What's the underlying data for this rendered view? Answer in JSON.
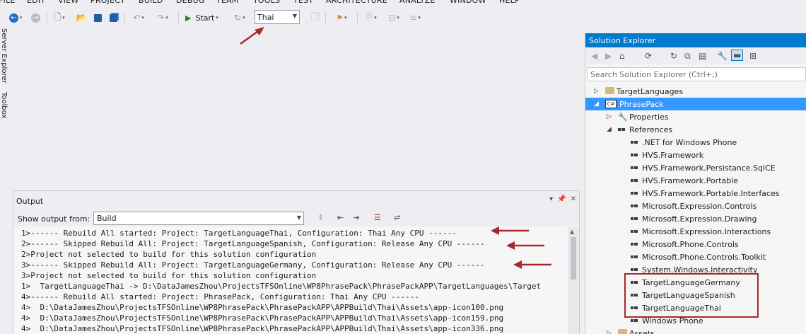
{
  "menu": [
    "FILE",
    "EDIT",
    "VIEW",
    "PROJECT",
    "BUILD",
    "DEBUG",
    "TEAM",
    "TOOLS",
    "TEST",
    "ARCHITECTURE",
    "ANALYZE",
    "WINDOW",
    "HELP"
  ],
  "toolbar": {
    "start_label": "Start",
    "configuration": "Thai"
  },
  "left_tabs": [
    "Server Explorer",
    "Toolbox"
  ],
  "output": {
    "title": "Output",
    "show_from_label": "Show output from:",
    "source": "Build",
    "lines": [
      "1>------ Rebuild All started: Project: TargetLanguageThai, Configuration: Thai Any CPU ------",
      "2>------ Skipped Rebuild All: Project: TargetLanguageSpanish, Configuration: Release Any CPU ------",
      "2>Project not selected to build for this solution configuration",
      "3>------ Skipped Rebuild All: Project: TargetLanguageGermany, Configuration: Release Any CPU ------",
      "3>Project not selected to build for this solution configuration",
      "1>  TargetLanguageThai -> D:\\DataJamesZhou\\ProjectsTFSOnline\\WP8PhrasePack\\PhrasePackAPP\\TargetLanguages\\Target",
      "4>------ Rebuild All started: Project: PhrasePack, Configuration: Thai Any CPU ------",
      "4>  D:\\DataJamesZhou\\ProjectsTFSOnline\\WP8PhrasePack\\PhrasePackAPP\\APPBuild\\Thai\\Assets\\app-icon100.png",
      "4>  D:\\DataJamesZhou\\ProjectsTFSOnline\\WP8PhrasePack\\PhrasePackAPP\\APPBuild\\Thai\\Assets\\app-icon159.png",
      "4>  D:\\DataJamesZhou\\ProjectsTFSOnline\\WP8PhrasePack\\PhrasePackAPP\\APPBuild\\Thai\\Assets\\app-icon336.png"
    ]
  },
  "solution_explorer": {
    "title": "Solution Explorer",
    "search_placeholder": "Search Solution Explorer (Ctrl+;)",
    "tree": [
      {
        "label": "TargetLanguages",
        "icon": "folder-icon",
        "expander": "collapsed"
      },
      {
        "label": "PhrasePack",
        "icon": "csharp-project-icon",
        "expander": "expanded",
        "selected": true
      },
      {
        "label": "Properties",
        "icon": "wrench-icon",
        "expander": "collapsed"
      },
      {
        "label": "References",
        "icon": "reference-icon",
        "expander": "expanded"
      },
      {
        "label": ".NET for Windows Phone",
        "icon": "reference-icon"
      },
      {
        "label": "HVS.Framework",
        "icon": "reference-icon"
      },
      {
        "label": "HVS.Framework.Persistance.SqlCE",
        "icon": "reference-icon"
      },
      {
        "label": "HVS.Framework.Portable",
        "icon": "reference-icon"
      },
      {
        "label": "HVS.Framework.Portable.Interfaces",
        "icon": "reference-icon"
      },
      {
        "label": "Microsoft.Expression.Controls",
        "icon": "reference-icon"
      },
      {
        "label": "Microsoft.Expression.Drawing",
        "icon": "reference-icon"
      },
      {
        "label": "Microsoft.Expression.Interactions",
        "icon": "reference-icon"
      },
      {
        "label": "Microsoft.Phone.Controls",
        "icon": "reference-icon"
      },
      {
        "label": "Microsoft.Phone.Controls.Toolkit",
        "icon": "reference-icon"
      },
      {
        "label": "System.Windows.Interactivity",
        "icon": "reference-icon"
      },
      {
        "label": "TargetLanguageGermany",
        "icon": "reference-icon"
      },
      {
        "label": "TargetLanguageSpanish",
        "icon": "reference-icon"
      },
      {
        "label": "TargetLanguageThai",
        "icon": "reference-icon"
      },
      {
        "label": "Windows Phone",
        "icon": "reference-icon"
      },
      {
        "label": "Assets",
        "icon": "folder-icon",
        "expander": "collapsed"
      }
    ]
  },
  "colors": {
    "accent": "#007acc",
    "selection": "#3399ff",
    "annotation": "#a8282c"
  }
}
